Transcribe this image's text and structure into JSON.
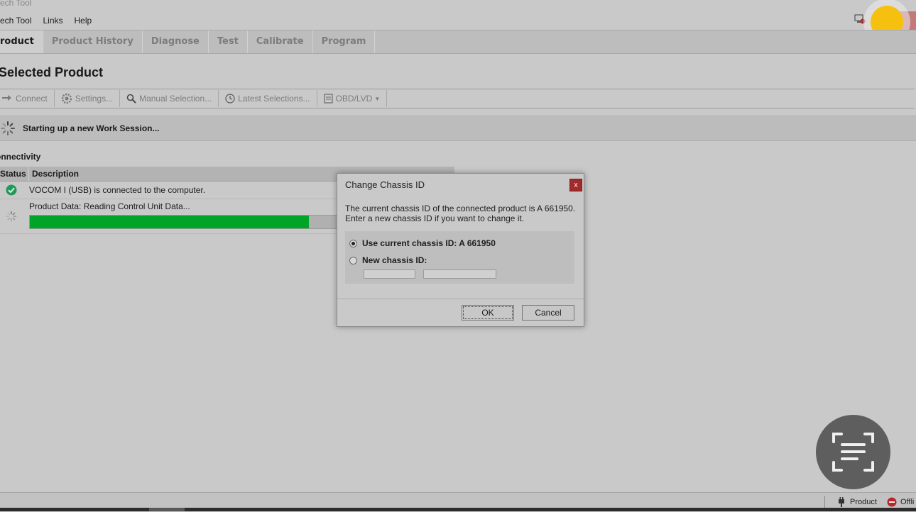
{
  "app": {
    "title": "ech Tool"
  },
  "menu": [
    "ech Tool",
    "Links",
    "Help"
  ],
  "tabs": [
    {
      "label": "roduct",
      "active": true
    },
    {
      "label": "Product History"
    },
    {
      "label": "Diagnose"
    },
    {
      "label": "Test"
    },
    {
      "label": "Calibrate"
    },
    {
      "label": "Program"
    }
  ],
  "page": {
    "title": "Selected Product"
  },
  "toolbar": {
    "connect": "Connect",
    "settings": "Settings...",
    "manual_selection": "Manual Selection...",
    "latest_selections": "Latest Selections...",
    "obd_lvd": "OBD/LVD"
  },
  "status": {
    "text": "Starting up a new Work Session..."
  },
  "connectivity": {
    "title": "onnectivity",
    "columns": [
      "Status",
      "Description"
    ],
    "rows": [
      {
        "status": "connected",
        "description": "VOCOM I (USB) is connected to the computer."
      },
      {
        "status": "loading",
        "description": "Product Data: Reading Control Unit Data...",
        "progress": 0.91
      }
    ]
  },
  "dialog": {
    "title": "Change Chassis ID",
    "close_label": "x",
    "message_line1": "The current chassis ID of the connected product is A 661950.",
    "message_line2": "Enter a new chassis ID if you want to change it.",
    "option_current": "Use current chassis ID: A 661950",
    "option_new": "New chassis ID:",
    "selected_option": "current",
    "new_id_series": "",
    "new_id_number": "",
    "ok": "OK",
    "cancel": "Cancel"
  },
  "bottom": {
    "product": "Product",
    "offline": "Offli"
  },
  "colors": {
    "progress": "#00a427",
    "connected": "#1e9b55",
    "close": "#a32a2a",
    "highlight_dot": "#f6c10e"
  }
}
